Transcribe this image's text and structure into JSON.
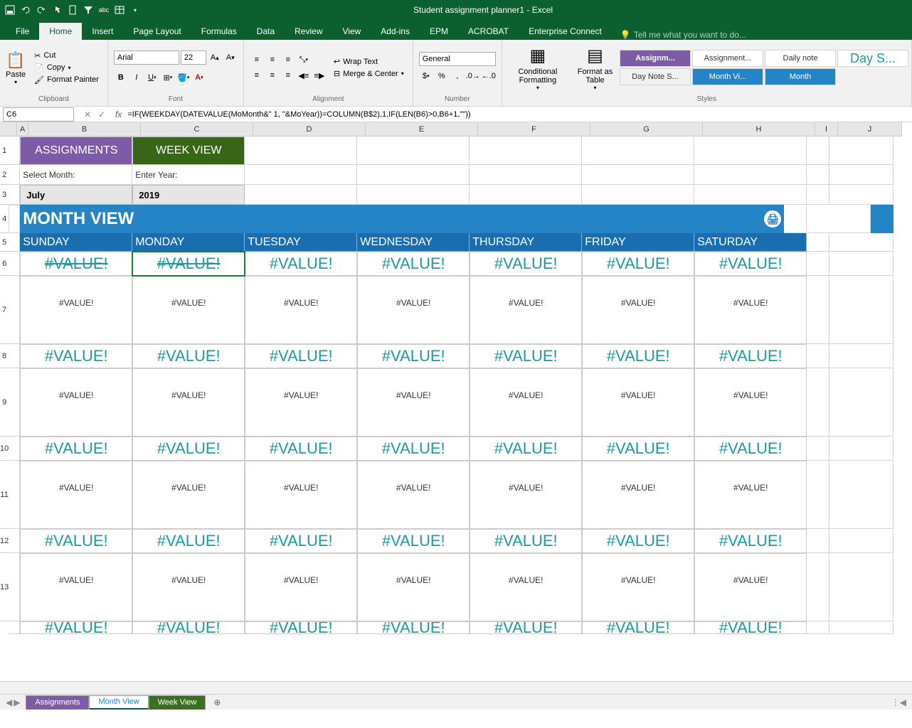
{
  "app": {
    "title": "Student assignment planner1 - Excel"
  },
  "ribbon": {
    "tabs": [
      "File",
      "Home",
      "Insert",
      "Page Layout",
      "Formulas",
      "Data",
      "Review",
      "View",
      "Add-ins",
      "EPM",
      "ACROBAT",
      "Enterprise Connect"
    ],
    "tell_me": "Tell me what you want to do...",
    "clipboard": {
      "paste": "Paste",
      "cut": "Cut",
      "copy": "Copy",
      "format_painter": "Format Painter",
      "label": "Clipboard"
    },
    "font": {
      "name": "Arial",
      "size": "22",
      "label": "Font"
    },
    "alignment": {
      "wrap": "Wrap Text",
      "merge": "Merge & Center",
      "label": "Alignment"
    },
    "number": {
      "format": "General",
      "label": "Number"
    },
    "styles": {
      "cond_format": "Conditional Formatting",
      "format_table": "Format as Table",
      "items": [
        "Assignm...",
        "Assignment...",
        "Daily note",
        "Day Note S...",
        "Day S...",
        "Month Vi...",
        "Month"
      ],
      "label": "Styles"
    }
  },
  "formula_bar": {
    "namebox": "C6",
    "formula": "=IF(WEEKDAY(DATEVALUE(MoMonth&\" 1, \"&MoYear))=COLUMN(B$2),1,IF(LEN(B6)>0,B6+1,\"\"))"
  },
  "columns": [
    "A",
    "B",
    "C",
    "D",
    "E",
    "F",
    "G",
    "H",
    "I",
    "J"
  ],
  "rows": [
    "1",
    "2",
    "3",
    "4",
    "5",
    "6",
    "7",
    "8",
    "9",
    "10",
    "11",
    "12",
    "13"
  ],
  "content": {
    "assignments_btn": "ASSIGNMENTS",
    "weekview_btn": "WEEK VIEW",
    "select_month_label": "Select Month:",
    "enter_year_label": "Enter Year:",
    "month": "July",
    "year": "2019",
    "title": "MONTH VIEW",
    "days": [
      "SUNDAY",
      "MONDAY",
      "TUESDAY",
      "WEDNESDAY",
      "THURSDAY",
      "FRIDAY",
      "SATURDAY"
    ],
    "value_err": "#VALUE!"
  },
  "sheet_tabs": {
    "assignments": "Assignments",
    "month_view": "Month View",
    "week_view": "Week View"
  }
}
